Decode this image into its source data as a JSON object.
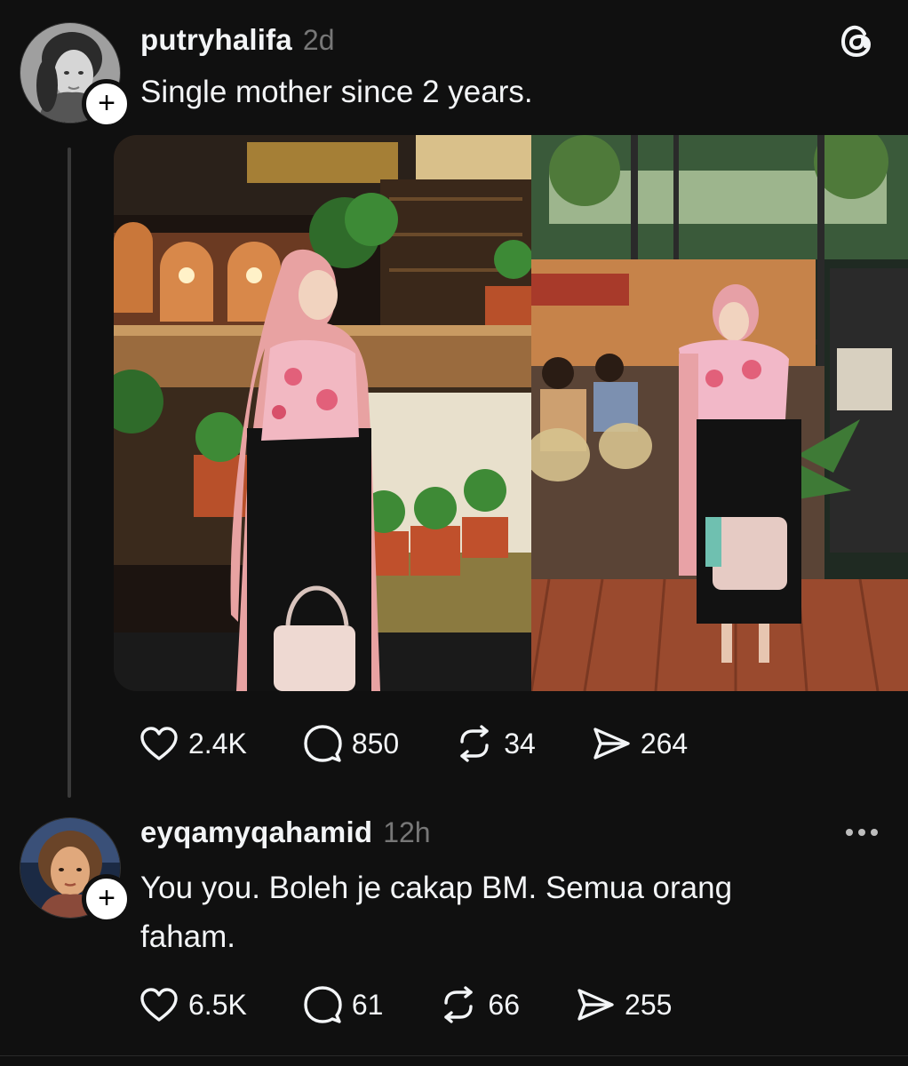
{
  "post": {
    "username": "putryhalifa",
    "time": "2d",
    "text": "Single mother since 2 years.",
    "stats": {
      "likes": "2.4K",
      "comments": "850",
      "reposts": "34",
      "shares": "264"
    }
  },
  "reply": {
    "username": "eyqamyqahamid",
    "time": "12h",
    "text_line1": "You you. Boleh je cakap BM. Semua orang",
    "text_line2": "faham.",
    "stats": {
      "likes": "6.5K",
      "comments": "61",
      "reposts": "66",
      "shares": "255"
    }
  },
  "icons": {
    "app_logo": "threads-logo-icon",
    "like": "heart-icon",
    "comment": "comment-bubble-icon",
    "repost": "repost-icon",
    "share": "send-icon",
    "more": "more-dots-icon",
    "follow": "plus-icon"
  },
  "colors": {
    "background": "#101010",
    "text": "#f3f5f7",
    "muted": "#777777",
    "thread_line": "#3a3a3a"
  }
}
